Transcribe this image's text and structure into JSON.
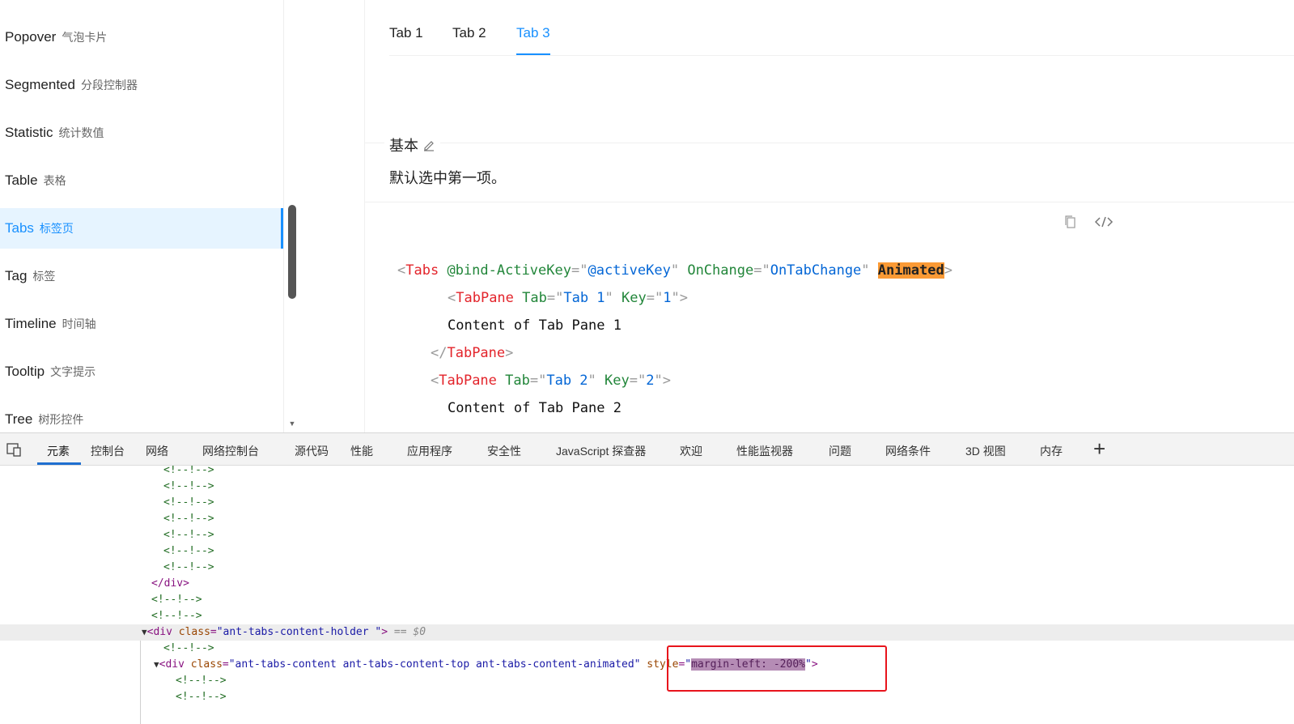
{
  "sidebar": {
    "items": [
      {
        "en": "Popover",
        "zh": "气泡卡片",
        "active": false
      },
      {
        "en": "Segmented",
        "zh": "分段控制器",
        "active": false
      },
      {
        "en": "Statistic",
        "zh": "统计数值",
        "active": false
      },
      {
        "en": "Table",
        "zh": "表格",
        "active": false
      },
      {
        "en": "Tabs",
        "zh": "标签页",
        "active": true
      },
      {
        "en": "Tag",
        "zh": "标签",
        "active": false
      },
      {
        "en": "Timeline",
        "zh": "时间轴",
        "active": false
      },
      {
        "en": "Tooltip",
        "zh": "文字提示",
        "active": false
      },
      {
        "en": "Tree",
        "zh": "树形控件",
        "active": false
      }
    ]
  },
  "demo": {
    "tabs": [
      "Tab 1",
      "Tab 2",
      "Tab 3"
    ],
    "active_tab": "Tab 3",
    "title": "基本",
    "description": "默认选中第一项。",
    "code": {
      "tag_tabs": "Tabs",
      "attr_bind": "@bind-ActiveKey",
      "val_bind": "@activeKey",
      "attr_onchange": "OnChange",
      "val_onchange": "OnTabChange",
      "attr_animated": "Animated",
      "tag_pane": "TabPane",
      "attr_tab": "Tab",
      "attr_key": "Key",
      "val_tab1": "Tab 1",
      "val_key1": "1",
      "content1": "Content of Tab Pane 1",
      "val_tab2": "Tab 2",
      "val_key2": "2",
      "content2": "Content of Tab Pane 2"
    }
  },
  "devtools": {
    "tabs": [
      "元素",
      "控制台",
      "网络",
      "网络控制台",
      "源代码",
      "性能",
      "应用程序",
      "安全性",
      "JavaScript 探查器",
      "欢迎",
      "性能监视器",
      "问题",
      "网络条件",
      "3D 视图",
      "内存"
    ],
    "active_tab": "元素",
    "add_label": "+",
    "dom": {
      "comment": "<!--!-->",
      "close_div": "</div>",
      "holder_open": "<div ",
      "attr_class": "class",
      "holder_class_val": "\"ant-tabs-content-holder \"",
      "gt": ">",
      "selected_marker": " == $0",
      "content_class_val": "\"ant-tabs-content ant-tabs-content-top ant-tabs-content-animated\"",
      "attr_style": "style",
      "style_val": "margin-left: -200%",
      "quote": "\""
    }
  }
}
